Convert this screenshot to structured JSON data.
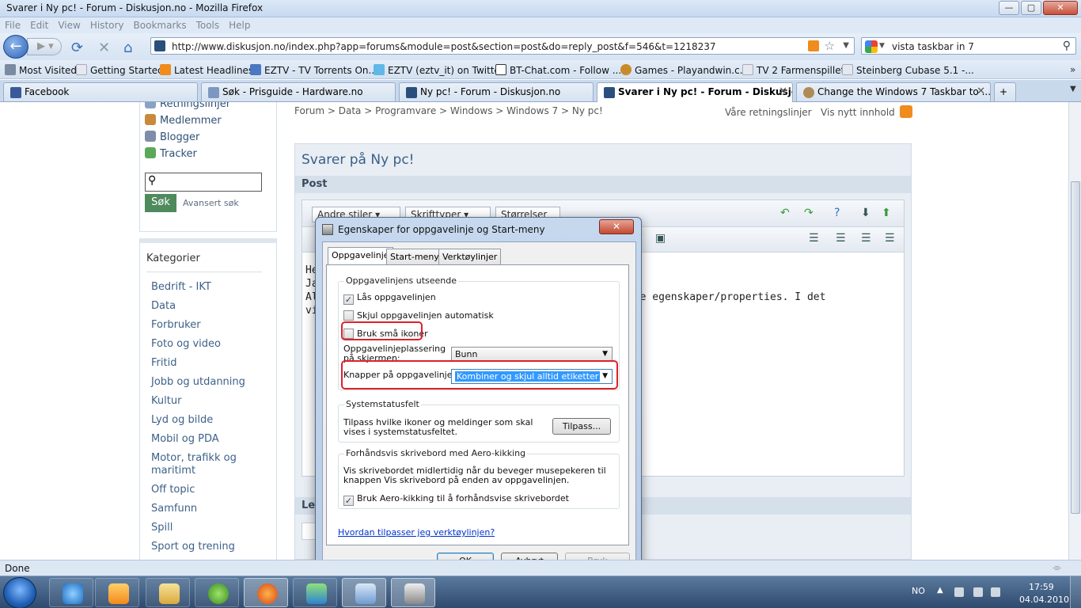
{
  "window": {
    "title": "Svarer i Ny pc! - Forum - Diskusjon.no - Mozilla Firefox",
    "min": "—",
    "max": "▢",
    "close": "✕"
  },
  "menu": [
    "File",
    "Edit",
    "View",
    "History",
    "Bookmarks",
    "Tools",
    "Help"
  ],
  "nav": {
    "url": "http://www.diskusjon.no/index.php?app=forums&module=post&section=post&do=reply_post&f=546&t=1218237",
    "search_query": "vista taskbar in 7"
  },
  "bookmarks": [
    "Most Visited",
    "Getting Started",
    "Latest Headlines",
    "EZTV - TV Torrents On...",
    "EZTV (eztv_it) on Twitter",
    "BT-Chat.com - Follow ...",
    "Games - Playandwin.c...",
    "TV 2 Farmenspillet",
    "Steinberg Cubase 5.1 -..."
  ],
  "tabs": [
    {
      "label": "Facebook"
    },
    {
      "label": "Søk - Prisguide - Hardware.no"
    },
    {
      "label": "Ny pc! - Forum - Diskusjon.no"
    },
    {
      "label": "Svarer i Ny pc! - Forum - Diskusjon..."
    },
    {
      "label": "Change the Windows 7 Taskbar to ..."
    }
  ],
  "sidebar": {
    "links": [
      "Retningslinjer",
      "Medlemmer",
      "Blogger",
      "Tracker"
    ],
    "search_button": "Søk",
    "advanced_search": "Avansert søk",
    "categories_title": "Kategorier",
    "categories": [
      "Bedrift - IKT",
      "Data",
      "Forbruker",
      "Foto og video",
      "Fritid",
      "Jobb og utdanning",
      "Kultur",
      "Lyd og bilde",
      "Mobil og PDA",
      "Motor, trafikk og maritimt",
      "Off topic",
      "Samfunn",
      "Spill",
      "Sport og trening"
    ]
  },
  "main": {
    "breadcrumb": "Forum  >  Data  >  Programvare  >  Windows  >  Windows 7  >  Ny pc!",
    "guidelines": "Våre retningslinjer",
    "new_content": "Vis nytt innhold",
    "post_title": "Svarer på Ny pc!",
    "post_label": "Post",
    "style_dropdown": "Andre stiler",
    "font_dropdown": "Skrifttyper",
    "size_dropdown": "Størrelser",
    "editor_lines": [
      "He",
      "",
      "Ja",
      "Al                                             og velge egenskaper/properties. I det",
      "vi"
    ],
    "bottom_label": "Le"
  },
  "dialog": {
    "title": "Egenskaper for oppgavelinje og Start-meny",
    "close": "✕",
    "tabs": [
      "Oppgavelinje",
      "Start-meny",
      "Verktøylinjer"
    ],
    "group_appearance": "Oppgavelinjens utseende",
    "cb_lock": "Lås oppgavelinjen",
    "cb_autohide": "Skjul oppgavelinjen automatisk",
    "cb_small": "Bruk små ikoner",
    "placement_label": "Oppgavelinjeplassering på skjermen:",
    "placement_value": "Bunn",
    "buttons_label": "Knapper på oppgavelinjen:",
    "buttons_value": "Kombiner og skjul alltid etiketter",
    "group_tray": "Systemstatusfelt",
    "tray_text": "Tilpass hvilke ikoner og meldinger som skal vises i systemstatusfeltet.",
    "customize_btn": "Tilpass...",
    "group_aero": "Forhåndsvis skrivebord med Aero-kikking",
    "aero_text": "Vis skrivebordet midlertidig når du beveger musepekeren til knappen Vis skrivebord på enden av oppgavelinjen.",
    "cb_aero": "Bruk Aero-kikking til å forhåndsvise skrivebordet",
    "help_link": "Hvordan tilpasser jeg verktøylinjen?",
    "ok": "OK",
    "cancel": "Avbryt",
    "apply": "Bruk",
    "checked_mark": "✓"
  },
  "status": {
    "text": "Done"
  },
  "taskbar": {
    "lang": "NO",
    "time": "17:59",
    "date": "04.04.2010"
  },
  "colors": {
    "accent": "#3a5f86",
    "highlight_red": "#e0202a",
    "link": "#3d6188"
  }
}
